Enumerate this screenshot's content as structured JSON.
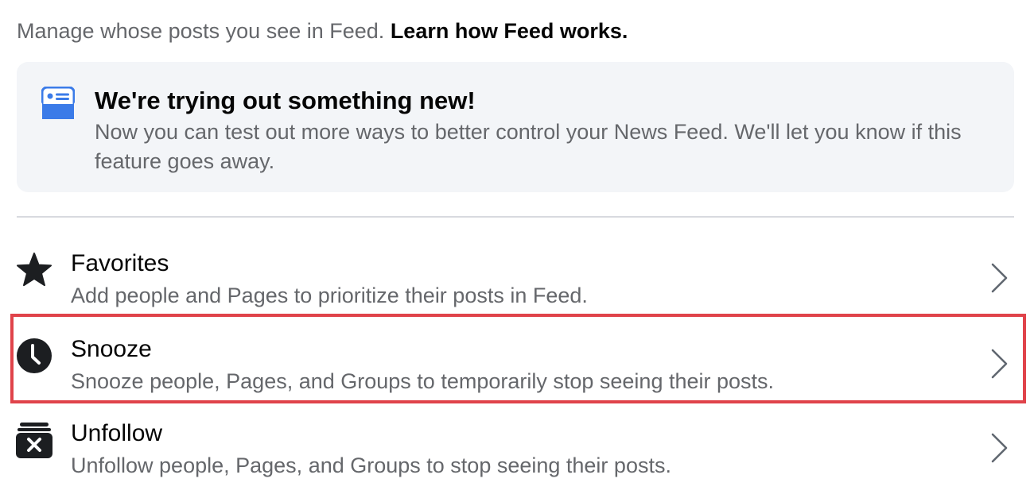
{
  "intro": {
    "text": "Manage whose posts you see in Feed.",
    "link": "Learn how Feed works."
  },
  "banner": {
    "icon": "news-feed-card-icon",
    "title": "We're trying out something new!",
    "description": "Now you can test out more ways to better control your News Feed. We'll let you know if this feature goes away."
  },
  "options": [
    {
      "icon": "star-icon",
      "title": "Favorites",
      "description": "Add people and Pages to prioritize their posts in Feed."
    },
    {
      "icon": "clock-icon",
      "title": "Snooze",
      "description": "Snooze people, Pages, and Groups to temporarily stop seeing their posts.",
      "highlighted": true
    },
    {
      "icon": "unfollow-icon",
      "title": "Unfollow",
      "description": "Unfollow people, Pages, and Groups to stop seeing their posts."
    }
  ],
  "colors": {
    "accent": "#3b7be8",
    "highlight": "#e0434a",
    "secondary_text": "#65676b",
    "banner_bg": "#f3f5f8"
  }
}
